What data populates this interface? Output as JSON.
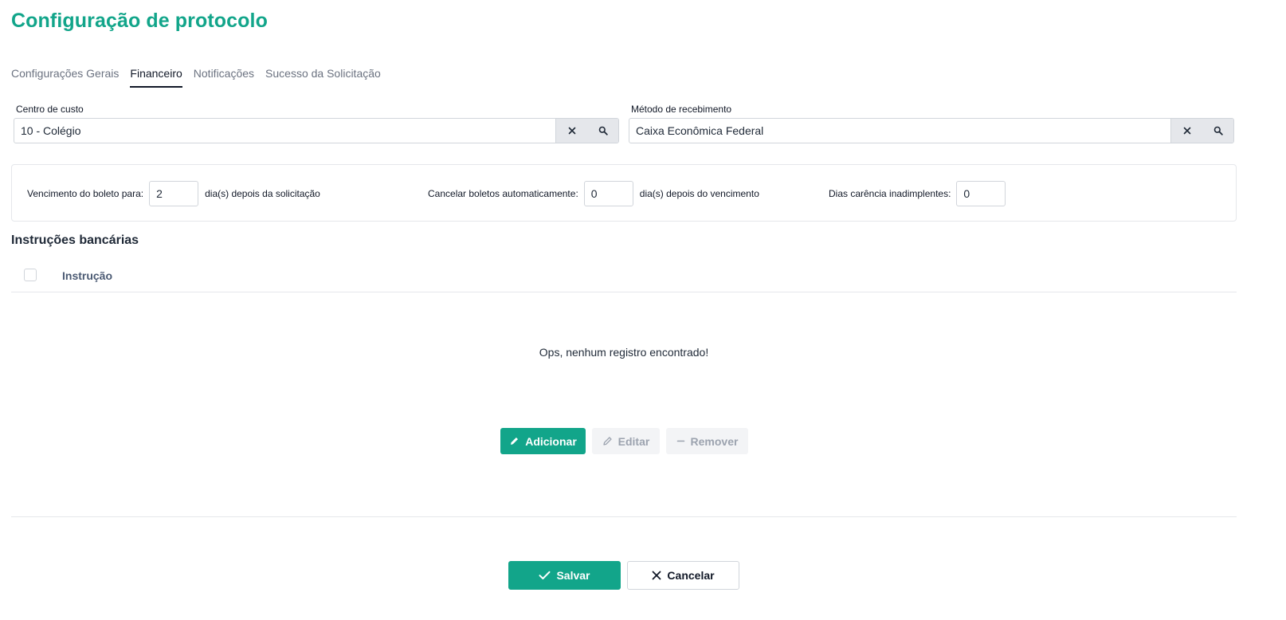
{
  "page": {
    "title": "Configuração de protocolo"
  },
  "tabs": [
    {
      "label": "Configurações Gerais",
      "active": false
    },
    {
      "label": "Financeiro",
      "active": true
    },
    {
      "label": "Notificações",
      "active": false
    },
    {
      "label": "Sucesso da Solicitação",
      "active": false
    }
  ],
  "cost_center": {
    "label": "Centro de custo",
    "value": "10 - Colégio",
    "clear_icon": "close-icon",
    "search_icon": "search-icon"
  },
  "payment_method": {
    "label": "Método de recebimento",
    "value": "Caixa Econômica Federal",
    "clear_icon": "close-icon",
    "search_icon": "search-icon"
  },
  "settings": {
    "due_label": "Vencimento do boleto para:",
    "due_value": "2",
    "due_suffix": "dia(s) depois da solicitação",
    "cancel_label": "Cancelar boletos automaticamente:",
    "cancel_value": "0",
    "cancel_suffix": "dia(s) depois do vencimento",
    "grace_label": "Dias carência inadimplentes:",
    "grace_value": "0"
  },
  "instructions": {
    "title": "Instruções bancárias",
    "column_header": "Instrução",
    "empty_message": "Ops, nenhum registro encontrado!",
    "add_label": "Adicionar",
    "edit_label": "Editar",
    "remove_label": "Remover"
  },
  "footer": {
    "save_label": "Salvar",
    "cancel_label": "Cancelar"
  },
  "colors": {
    "accent": "#12a58a",
    "text": "#1f2937",
    "muted": "#6b7280",
    "border": "#d1d5db"
  }
}
